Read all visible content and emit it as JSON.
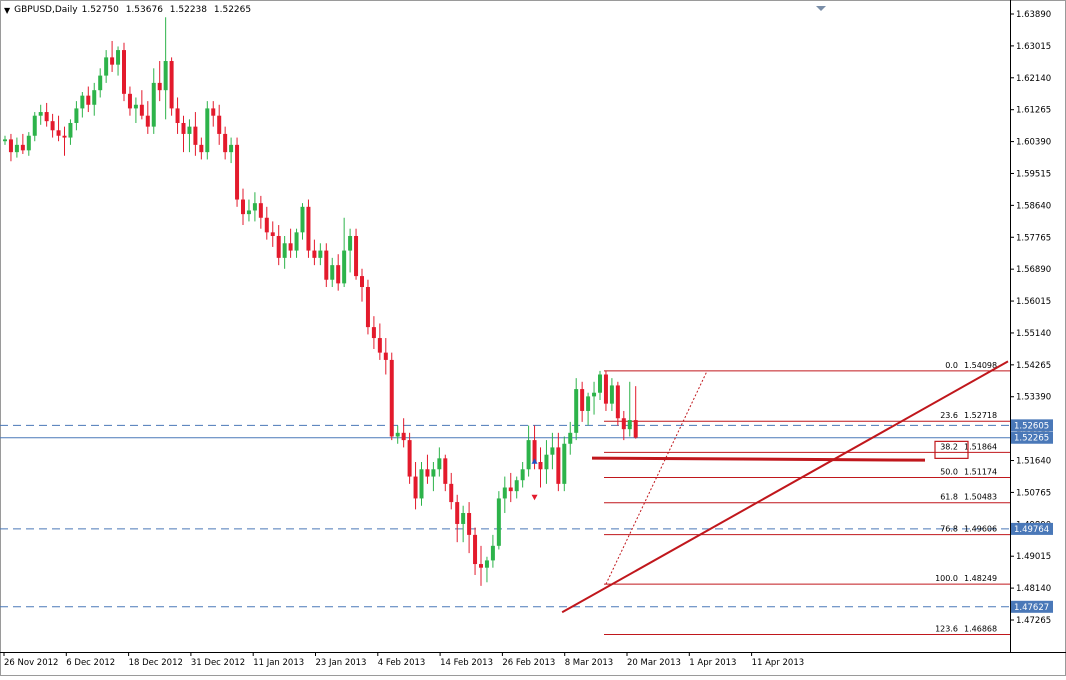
{
  "header": {
    "symbol": "GBPUSD,Daily",
    "open": "1.52750",
    "high": "1.53676",
    "low": "1.52238",
    "close": "1.52265",
    "menu_icon": "triangle-down-icon"
  },
  "colors": {
    "bull": "#2db34a",
    "bear": "#e31a2c",
    "lines": "#c0171c",
    "dashed": "#4a78b8",
    "axis_text": "#000000"
  },
  "y_axis": {
    "min": 1.462,
    "max": 1.643,
    "tick_labels": [
      "1.63890",
      "1.63015",
      "1.62140",
      "1.61265",
      "1.60390",
      "1.59515",
      "1.58640",
      "1.57765",
      "1.56890",
      "1.56015",
      "1.55140",
      "1.54265",
      "1.53390",
      "1.52515",
      "1.51640",
      "1.50765",
      "1.49890",
      "1.49015",
      "1.48140",
      "1.47265"
    ]
  },
  "x_axis": {
    "date_labels": [
      "26 Nov 2012",
      "6 Dec 2012",
      "18 Dec 2012",
      "31 Dec 2012",
      "11 Jan 2013",
      "23 Jan 2013",
      "4 Feb 2013",
      "14 Feb 2013",
      "26 Feb 2013",
      "8 Mar 2013",
      "20 Mar 2013",
      "1 Apr 2013",
      "11 Apr 2013"
    ]
  },
  "price_tags": [
    {
      "label": "1.52605",
      "value": 1.52605,
      "style": "dashed"
    },
    {
      "label": "1.52265",
      "value": 1.52265,
      "style": "solid"
    },
    {
      "label": "1.49764",
      "value": 1.49764,
      "style": "dashed"
    },
    {
      "label": "1.47627",
      "value": 1.47627,
      "style": "dashed"
    }
  ],
  "fibonacci": [
    {
      "level": "0.0",
      "price": "1.54098",
      "value": 1.54098
    },
    {
      "level": "23.6",
      "price": "1.52718",
      "value": 1.52718
    },
    {
      "level": "38.2",
      "price": "1.51864",
      "value": 1.51864
    },
    {
      "level": "50.0",
      "price": "1.51174",
      "value": 1.51174
    },
    {
      "level": "61.8",
      "price": "1.50483",
      "value": 1.50483
    },
    {
      "level": "76.8",
      "price": "1.49606",
      "value": 1.49606
    },
    {
      "level": "100.0",
      "price": "1.48249",
      "value": 1.48249
    },
    {
      "level": "123.6",
      "price": "1.46868",
      "value": 1.46868
    }
  ],
  "trendline": {
    "from": {
      "bar": 97,
      "price": 1.4797
    },
    "to": {
      "bar": 139,
      "price": 1.5425
    }
  },
  "horizontal_support": {
    "from_bar": 98,
    "to_bar": 153,
    "price": 1.51705
  },
  "fib_anchor": {
    "from": {
      "bar": 101,
      "price": 1.48249
    },
    "to": {
      "bar": 118,
      "price": 1.54098
    }
  },
  "candles": [
    [
      1.604,
      1.6055,
      1.603,
      1.6045
    ],
    [
      1.6045,
      1.606,
      1.5985,
      1.601
    ],
    [
      1.601,
      1.605,
      1.5995,
      1.603
    ],
    [
      1.603,
      1.606,
      1.6005,
      1.6015
    ],
    [
      1.6015,
      1.6065,
      1.6,
      1.6055
    ],
    [
      1.6055,
      1.612,
      1.604,
      1.611
    ],
    [
      1.611,
      1.614,
      1.6085,
      1.612
    ],
    [
      1.612,
      1.6145,
      1.608,
      1.6095
    ],
    [
      1.6095,
      1.6115,
      1.605,
      1.607
    ],
    [
      1.607,
      1.611,
      1.604,
      1.6055
    ],
    [
      1.6055,
      1.608,
      1.6,
      1.605
    ],
    [
      1.605,
      1.61,
      1.603,
      1.609
    ],
    [
      1.609,
      1.615,
      1.607,
      1.613
    ],
    [
      1.613,
      1.6175,
      1.6105,
      1.6165
    ],
    [
      1.6165,
      1.619,
      1.612,
      1.614
    ],
    [
      1.614,
      1.62,
      1.611,
      1.618
    ],
    [
      1.618,
      1.624,
      1.616,
      1.622
    ],
    [
      1.622,
      1.629,
      1.62,
      1.627
    ],
    [
      1.627,
      1.6315,
      1.623,
      1.625
    ],
    [
      1.625,
      1.63,
      1.622,
      1.629
    ],
    [
      1.629,
      1.631,
      1.615,
      1.617
    ],
    [
      1.617,
      1.619,
      1.611,
      1.613
    ],
    [
      1.613,
      1.616,
      1.609,
      1.614
    ],
    [
      1.614,
      1.618,
      1.61,
      1.611
    ],
    [
      1.611,
      1.615,
      1.606,
      1.608
    ],
    [
      1.608,
      1.624,
      1.606,
      1.62
    ],
    [
      1.62,
      1.626,
      1.615,
      1.618
    ],
    [
      1.618,
      1.638,
      1.61,
      1.626
    ],
    [
      1.626,
      1.627,
      1.611,
      1.613
    ],
    [
      1.613,
      1.616,
      1.606,
      1.609
    ],
    [
      1.609,
      1.611,
      1.601,
      1.606
    ],
    [
      1.606,
      1.61,
      1.601,
      1.608
    ],
    [
      1.608,
      1.612,
      1.6,
      1.603
    ],
    [
      1.603,
      1.605,
      1.599,
      1.601
    ],
    [
      1.601,
      1.615,
      1.599,
      1.613
    ],
    [
      1.613,
      1.615,
      1.608,
      1.611
    ],
    [
      1.611,
      1.614,
      1.603,
      1.606
    ],
    [
      1.606,
      1.608,
      1.599,
      1.601
    ],
    [
      1.601,
      1.605,
      1.598,
      1.603
    ],
    [
      1.603,
      1.605,
      1.586,
      1.588
    ],
    [
      1.588,
      1.591,
      1.581,
      1.584
    ],
    [
      1.584,
      1.588,
      1.582,
      1.585
    ],
    [
      1.585,
      1.59,
      1.582,
      1.587
    ],
    [
      1.587,
      1.589,
      1.58,
      1.583
    ],
    [
      1.583,
      1.586,
      1.577,
      1.579
    ],
    [
      1.579,
      1.582,
      1.575,
      1.578
    ],
    [
      1.578,
      1.581,
      1.57,
      1.572
    ],
    [
      1.572,
      1.578,
      1.569,
      1.576
    ],
    [
      1.576,
      1.58,
      1.572,
      1.574
    ],
    [
      1.574,
      1.58,
      1.572,
      1.579
    ],
    [
      1.579,
      1.587,
      1.577,
      1.586
    ],
    [
      1.586,
      1.588,
      1.572,
      1.574
    ],
    [
      1.574,
      1.577,
      1.57,
      1.572
    ],
    [
      1.572,
      1.576,
      1.57,
      1.574
    ],
    [
      1.574,
      1.576,
      1.564,
      1.566
    ],
    [
      1.566,
      1.572,
      1.564,
      1.57
    ],
    [
      1.57,
      1.573,
      1.563,
      1.565
    ],
    [
      1.565,
      1.583,
      1.564,
      1.574
    ],
    [
      1.574,
      1.58,
      1.568,
      1.578
    ],
    [
      1.578,
      1.58,
      1.566,
      1.567
    ],
    [
      1.567,
      1.569,
      1.56,
      1.564
    ],
    [
      1.564,
      1.566,
      1.551,
      1.553
    ],
    [
      1.553,
      1.556,
      1.547,
      1.55
    ],
    [
      1.55,
      1.554,
      1.544,
      1.546
    ],
    [
      1.546,
      1.55,
      1.54,
      1.544
    ],
    [
      1.544,
      1.546,
      1.522,
      1.523
    ],
    [
      1.523,
      1.526,
      1.521,
      1.524
    ],
    [
      1.524,
      1.528,
      1.52,
      1.522
    ],
    [
      1.522,
      1.524,
      1.51,
      1.512
    ],
    [
      1.512,
      1.516,
      1.503,
      1.506
    ],
    [
      1.506,
      1.516,
      1.504,
      1.514
    ],
    [
      1.514,
      1.518,
      1.51,
      1.512
    ],
    [
      1.512,
      1.516,
      1.508,
      1.514
    ],
    [
      1.514,
      1.52,
      1.512,
      1.517
    ],
    [
      1.517,
      1.518,
      1.508,
      1.51
    ],
    [
      1.51,
      1.513,
      1.503,
      1.505
    ],
    [
      1.505,
      1.507,
      1.494,
      1.499
    ],
    [
      1.499,
      1.504,
      1.494,
      1.502
    ],
    [
      1.502,
      1.505,
      1.491,
      1.496
    ],
    [
      1.496,
      1.498,
      1.485,
      1.488
    ],
    [
      1.488,
      1.493,
      1.482,
      1.487
    ],
    [
      1.487,
      1.49,
      1.483,
      1.489
    ],
    [
      1.489,
      1.496,
      1.487,
      1.493
    ],
    [
      1.493,
      1.508,
      1.492,
      1.506
    ],
    [
      1.506,
      1.512,
      1.502,
      1.509
    ],
    [
      1.509,
      1.513,
      1.505,
      1.508
    ],
    [
      1.508,
      1.512,
      1.506,
      1.511
    ],
    [
      1.511,
      1.516,
      1.509,
      1.514
    ],
    [
      1.514,
      1.526,
      1.512,
      1.522
    ],
    [
      1.522,
      1.526,
      1.514,
      1.516
    ],
    [
      1.516,
      1.52,
      1.509,
      1.514
    ],
    [
      1.514,
      1.522,
      1.51,
      1.518
    ],
    [
      1.518,
      1.524,
      1.514,
      1.52
    ],
    [
      1.52,
      1.524,
      1.508,
      1.51
    ],
    [
      1.51,
      1.523,
      1.508,
      1.521
    ],
    [
      1.521,
      1.527,
      1.518,
      1.524
    ],
    [
      1.524,
      1.539,
      1.522,
      1.536
    ],
    [
      1.536,
      1.538,
      1.527,
      1.53
    ],
    [
      1.53,
      1.535,
      1.526,
      1.534
    ],
    [
      1.534,
      1.538,
      1.529,
      1.535
    ],
    [
      1.535,
      1.541,
      1.533,
      1.54
    ],
    [
      1.54,
      1.541,
      1.53,
      1.532
    ],
    [
      1.532,
      1.539,
      1.53,
      1.537
    ],
    [
      1.537,
      1.538,
      1.526,
      1.528
    ],
    [
      1.528,
      1.53,
      1.522,
      1.525
    ],
    [
      1.525,
      1.538,
      1.523,
      1.5275
    ],
    [
      1.5275,
      1.5368,
      1.5224,
      1.5227
    ]
  ]
}
